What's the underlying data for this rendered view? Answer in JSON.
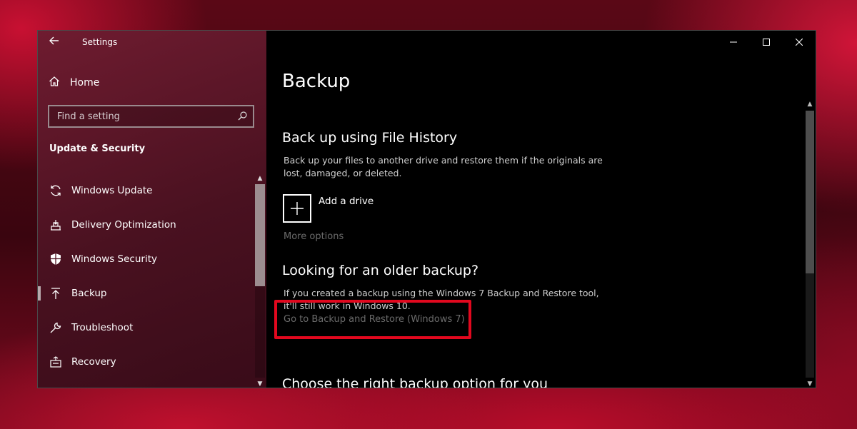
{
  "window": {
    "app_title": "Settings",
    "back_icon": "back-arrow-icon",
    "controls": [
      "minimize-icon",
      "maximize-icon",
      "close-icon"
    ]
  },
  "sidebar": {
    "home_label": "Home",
    "search_placeholder": "Find a setting",
    "section_title": "Update & Security",
    "items": [
      {
        "label": "Windows Update",
        "icon": "sync-icon",
        "active": false
      },
      {
        "label": "Delivery Optimization",
        "icon": "delivery-optimization-icon",
        "active": false
      },
      {
        "label": "Windows Security",
        "icon": "shield-icon",
        "active": false
      },
      {
        "label": "Backup",
        "icon": "backup-arrow-icon",
        "active": true
      },
      {
        "label": "Troubleshoot",
        "icon": "wrench-icon",
        "active": false
      },
      {
        "label": "Recovery",
        "icon": "recovery-icon",
        "active": false
      }
    ]
  },
  "main": {
    "page_title": "Backup",
    "file_history": {
      "heading": "Back up using File History",
      "description": "Back up your files to another drive and restore them if the originals are lost, damaged, or deleted.",
      "add_drive_label": "Add a drive",
      "more_options": "More options"
    },
    "older_backup": {
      "heading": "Looking for an older backup?",
      "description": "If you created a backup using the Windows 7 Backup and Restore tool, it'll still work in Windows 10.",
      "link": "Go to Backup and Restore (Windows 7)"
    },
    "right_option_heading": "Choose the right backup option for you"
  },
  "colors": {
    "highlight_box": "#e1081e",
    "sidebar_bg": "#4e1222",
    "main_bg": "#000000"
  }
}
